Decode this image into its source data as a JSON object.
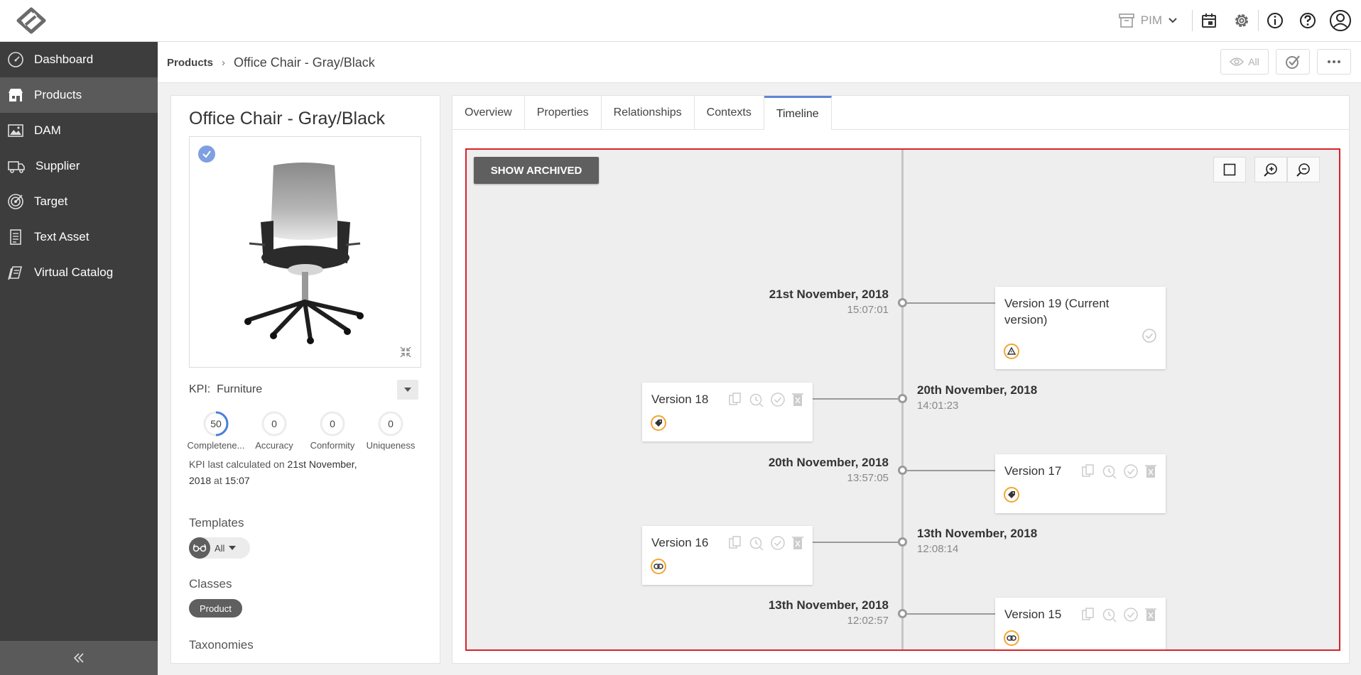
{
  "topbar": {
    "module": "PIM"
  },
  "sidebar": {
    "items": [
      {
        "label": "Dashboard"
      },
      {
        "label": "Products"
      },
      {
        "label": "DAM"
      },
      {
        "label": "Supplier"
      },
      {
        "label": "Target"
      },
      {
        "label": "Text Asset"
      },
      {
        "label": "Virtual Catalog"
      }
    ]
  },
  "breadcrumb": {
    "parent": "Products",
    "separator": "›",
    "current": "Office Chair - Gray/Black"
  },
  "actions": {
    "visibility_label": "All"
  },
  "product": {
    "title": "Office Chair - Gray/Black",
    "kpi_label": "KPI:",
    "kpi_value": "Furniture",
    "kpis": [
      {
        "value": "50",
        "name": "Completene...",
        "progress": 0.5
      },
      {
        "value": "0",
        "name": "Accuracy",
        "progress": 0
      },
      {
        "value": "0",
        "name": "Conformity",
        "progress": 0
      },
      {
        "value": "0",
        "name": "Uniqueness",
        "progress": 0
      }
    ],
    "kpi_note_prefix": "KPI last calculated on",
    "kpi_note_date": "21st November, 2018",
    "kpi_note_at": "at",
    "kpi_note_time": "15:07",
    "templates_label": "Templates",
    "templates_value": "All",
    "classes_label": "Classes",
    "class_value": "Product",
    "taxonomies_label": "Taxonomies"
  },
  "tabs": [
    {
      "label": "Overview"
    },
    {
      "label": "Properties"
    },
    {
      "label": "Relationships"
    },
    {
      "label": "Contexts"
    },
    {
      "label": "Timeline"
    }
  ],
  "timeline": {
    "show_archived": "SHOW ARCHIVED",
    "entries": [
      {
        "date": "21st November, 2018",
        "time": "15:07:01",
        "version": "Version 19 (Current version)",
        "badge": "warning-icon"
      },
      {
        "date": "20th November, 2018",
        "time": "14:01:23",
        "version": "Version 18",
        "badge": "tag-icon"
      },
      {
        "date": "20th November, 2018",
        "time": "13:57:05",
        "version": "Version 17",
        "badge": "tag-icon"
      },
      {
        "date": "13th November, 2018",
        "time": "12:08:14",
        "version": "Version 16",
        "badge": "link-icon"
      },
      {
        "date": "13th November, 2018",
        "time": "12:02:57",
        "version": "Version 15",
        "badge": "link-icon"
      }
    ]
  },
  "colors": {
    "sidebar": "#3d3d3d",
    "active_tab": "#5b86d6",
    "highlight_border": "#d8232a",
    "badge": "#f2a530"
  }
}
